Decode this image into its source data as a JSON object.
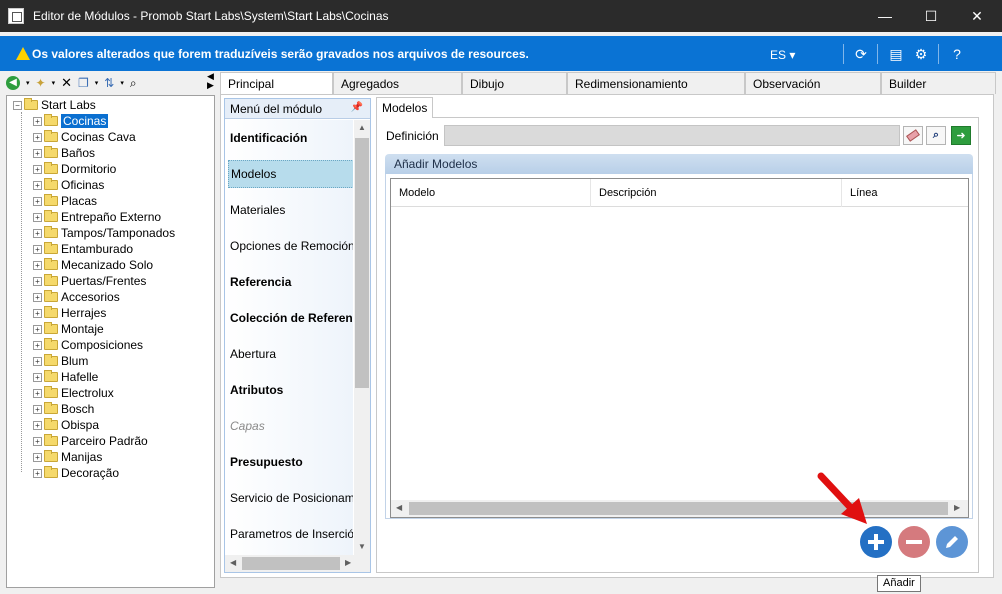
{
  "window": {
    "title": "Editor de Módulos - Promob Start Labs\\System\\Start Labs\\Cocinas",
    "minimize": "—",
    "maximize": "☐",
    "close": "✕"
  },
  "infobar": {
    "message": "Os valores alterados que forem traduzíveis serão gravados nos arquivos de resources.",
    "language": "ES ▾",
    "accent_color": "#0a73d4"
  },
  "tree": {
    "root": "Start Labs",
    "items": [
      {
        "label": "Cocinas",
        "selected": true
      },
      {
        "label": "Cocinas Cava"
      },
      {
        "label": "Baños"
      },
      {
        "label": "Dormitorio"
      },
      {
        "label": "Oficinas"
      },
      {
        "label": "Placas"
      },
      {
        "label": "Entrepaño Externo"
      },
      {
        "label": "Tampos/Tamponados"
      },
      {
        "label": "Entamburado"
      },
      {
        "label": "Mecanizado Solo"
      },
      {
        "label": "Puertas/Frentes"
      },
      {
        "label": "Accesorios"
      },
      {
        "label": "Herrajes"
      },
      {
        "label": "Montaje"
      },
      {
        "label": "Composiciones"
      },
      {
        "label": "Blum"
      },
      {
        "label": "Hafelle"
      },
      {
        "label": "Electrolux"
      },
      {
        "label": "Bosch"
      },
      {
        "label": "Obispa"
      },
      {
        "label": "Parceiro Padrão"
      },
      {
        "label": "Manijas"
      },
      {
        "label": "Decoração"
      }
    ]
  },
  "tabs": [
    {
      "label": "Principal",
      "active": true
    },
    {
      "label": "Agregados"
    },
    {
      "label": "Dibujo"
    },
    {
      "label": "Redimensionamiento"
    },
    {
      "label": "Observación"
    },
    {
      "label": "Builder"
    }
  ],
  "menu": {
    "header": "Menú del módulo",
    "pin": "ᵖ",
    "items": [
      {
        "label": "Identificación",
        "style": "bold"
      },
      {
        "label": "Modelos",
        "style": "selected"
      },
      {
        "label": "Materiales",
        "style": "normal"
      },
      {
        "label": "Opciones de Remoción",
        "style": "normal"
      },
      {
        "label": "Referencia",
        "style": "bold"
      },
      {
        "label": "Colección de Referencia",
        "style": "bold"
      },
      {
        "label": "Abertura",
        "style": "normal"
      },
      {
        "label": "Atributos",
        "style": "bold"
      },
      {
        "label": "Capas",
        "style": "italic"
      },
      {
        "label": "Presupuesto",
        "style": "bold"
      },
      {
        "label": "Servicio de Posicionamiento",
        "style": "normal"
      },
      {
        "label": "Parametros de Inserción",
        "style": "normal"
      }
    ]
  },
  "content": {
    "subtab": "Modelos",
    "definition_label": "Definición",
    "definition_value": "",
    "group_title": "Añadir Modelos",
    "columns": [
      "Modelo",
      "Descripción",
      "Línea"
    ]
  },
  "tooltip": "Añadir"
}
